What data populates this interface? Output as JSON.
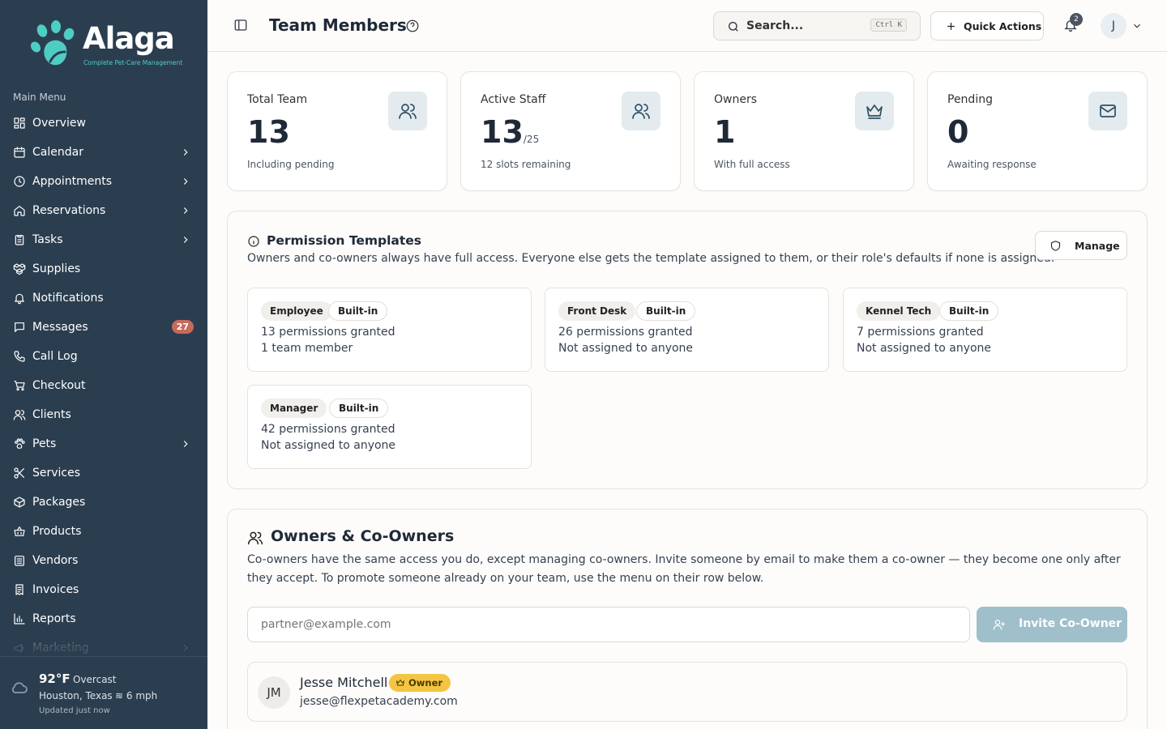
{
  "sidebar": {
    "brand": {
      "name": "Alaga",
      "tagline": "Complete Pet-Care Management",
      "accent": "#4ecdc4"
    },
    "menu_heading": "Main Menu",
    "items": [
      {
        "label": "Overview",
        "icon": "grid-icon",
        "has_children": false
      },
      {
        "label": "Calendar",
        "icon": "calendar-icon",
        "has_children": true
      },
      {
        "label": "Appointments",
        "icon": "clock-icon",
        "has_children": true
      },
      {
        "label": "Reservations",
        "icon": "home-icon",
        "has_children": true
      },
      {
        "label": "Tasks",
        "icon": "clipboard-icon",
        "has_children": true
      },
      {
        "label": "Supplies",
        "icon": "boxes-icon",
        "has_children": false
      },
      {
        "label": "Notifications",
        "icon": "bell-icon",
        "has_children": false
      },
      {
        "label": "Messages",
        "icon": "message-icon",
        "has_children": false,
        "badge": "27"
      },
      {
        "label": "Call Log",
        "icon": "phone-icon",
        "has_children": false
      },
      {
        "label": "Checkout",
        "icon": "cart-icon",
        "has_children": false
      },
      {
        "label": "Clients",
        "icon": "users-icon",
        "has_children": false
      },
      {
        "label": "Pets",
        "icon": "paw-icon",
        "has_children": true
      },
      {
        "label": "Services",
        "icon": "scissors-icon",
        "has_children": false
      },
      {
        "label": "Packages",
        "icon": "package-icon",
        "has_children": false
      },
      {
        "label": "Products",
        "icon": "basket-icon",
        "has_children": false
      },
      {
        "label": "Vendors",
        "icon": "building-icon",
        "has_children": false
      },
      {
        "label": "Invoices",
        "icon": "receipt-icon",
        "has_children": false
      },
      {
        "label": "Reports",
        "icon": "bar-chart-icon",
        "has_children": false
      },
      {
        "label": "Marketing",
        "icon": "megaphone-icon",
        "has_children": true
      }
    ],
    "weather": {
      "temp": "92°F",
      "condition": "Overcast",
      "location": "Houston, Texas",
      "wind": "6 mph",
      "updated": "Updated just now"
    }
  },
  "header": {
    "title": "Team Members",
    "search_placeholder": "Search...",
    "search_shortcut": "Ctrl K",
    "quick_actions": "Quick Actions",
    "notification_count": "2",
    "user_initial": "J"
  },
  "stats": [
    {
      "label": "Total Team",
      "value": "13",
      "caption": "",
      "sub": "Including pending",
      "icon": "users-icon"
    },
    {
      "label": "Active Staff",
      "value": "13",
      "caption": "/25",
      "sub": "12 slots remaining",
      "icon": "users-icon"
    },
    {
      "label": "Owners",
      "value": "1",
      "caption": "",
      "sub": "With full access",
      "icon": "crown-icon"
    },
    {
      "label": "Pending",
      "value": "0",
      "caption": "",
      "sub": "Awaiting response",
      "icon": "mail-icon"
    }
  ],
  "permission_templates": {
    "title": "Permission Templates",
    "description": "Owners and co-owners always have full access. Everyone else gets the template assigned to them, or their role's defaults if none is assigned.",
    "manage_label": "Manage",
    "templates": [
      {
        "name": "Employee",
        "tag": "Built-in",
        "permissions": "13 permissions granted",
        "assigned": "1 team member"
      },
      {
        "name": "Front Desk",
        "tag": "Built-in",
        "permissions": "26 permissions granted",
        "assigned": "Not assigned to anyone"
      },
      {
        "name": "Kennel Tech",
        "tag": "Built-in",
        "permissions": "7 permissions granted",
        "assigned": "Not assigned to anyone"
      },
      {
        "name": "Manager",
        "tag": "Built-in",
        "permissions": "42 permissions granted",
        "assigned": "Not assigned to anyone"
      }
    ]
  },
  "owners": {
    "title": "Owners & Co-Owners",
    "description": "Co-owners have the same access you do, except managing co-owners. Invite someone by email to make them a co-owner — they become one only after they accept. To promote someone already on your team, use the menu on their row below.",
    "invite_placeholder": "partner@example.com",
    "invite_button": "Invite Co-Owner",
    "members": [
      {
        "initials": "JM",
        "name": "Jesse Mitchell",
        "role": "Owner",
        "email": "jesse@flexpetacademy.com"
      }
    ]
  }
}
